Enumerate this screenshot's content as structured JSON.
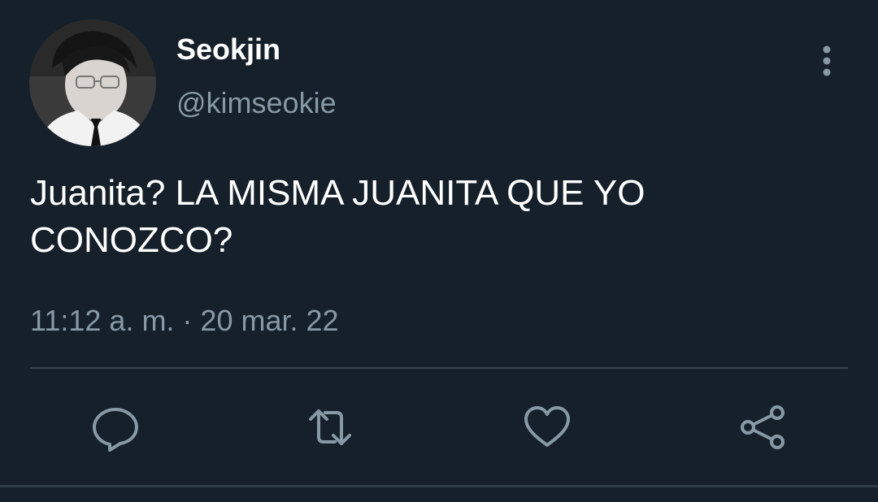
{
  "user": {
    "display_name": "Seokjin",
    "handle": "@kimseokie",
    "avatar_icon": "profile-photo"
  },
  "tweet": {
    "text": "Juanita? LA MISMA JUANITA QUE YO CONOZCO?",
    "timestamp": "11:12 a. m. · 20 mar. 22"
  },
  "actions": {
    "more_icon": "vertical-dots-icon",
    "reply_icon": "reply-bubble-icon",
    "retweet_icon": "retweet-icon",
    "like_icon": "heart-icon",
    "share_icon": "share-icon"
  },
  "colors": {
    "background": "#15202b",
    "text_primary": "#ffffff",
    "text_secondary": "#8899a6",
    "icon": "#8899a6",
    "divider": "#38444d"
  }
}
